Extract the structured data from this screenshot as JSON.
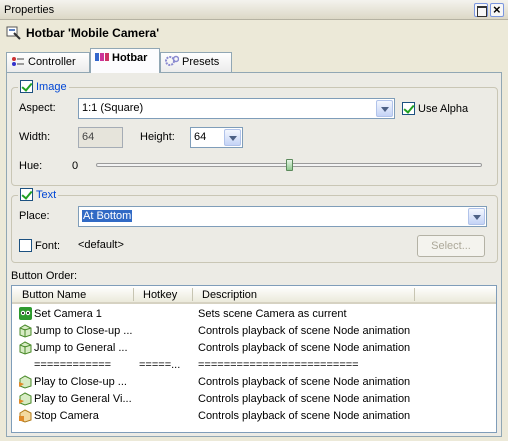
{
  "window": {
    "title": "Properties"
  },
  "header": {
    "title": "Hotbar 'Mobile Camera'"
  },
  "tabs": [
    {
      "label": "Controller",
      "icon": "controller-icon"
    },
    {
      "label": "Hotbar",
      "icon": "hotbar-icon"
    },
    {
      "label": "Presets",
      "icon": "presets-icon"
    }
  ],
  "image_group": {
    "title": "Image",
    "checked": true,
    "aspect_label": "Aspect:",
    "aspect_value": "1:1   (Square)",
    "use_alpha_label": "Use Alpha",
    "use_alpha_checked": true,
    "width_label": "Width:",
    "width_value": "64",
    "height_label": "Height:",
    "height_value": "64",
    "hue_label": "Hue:",
    "hue_value": "0",
    "hue_slider_fraction": 0.5
  },
  "text_group": {
    "title": "Text",
    "checked": true,
    "place_label": "Place:",
    "place_value": "At Bottom",
    "font_label": "Font:",
    "font_checked": false,
    "font_value": "<default>",
    "select_button": "Select..."
  },
  "button_order": {
    "label": "Button Order:",
    "columns": [
      "Button Name",
      "Hotkey",
      "Description"
    ],
    "rows": [
      {
        "name": "Set Camera 1",
        "hotkey": "",
        "description": "Sets scene Camera as current",
        "icon": "camera-icon"
      },
      {
        "name": "Jump to Close-up ...",
        "hotkey": "",
        "description": "Controls playback of scene Node animation",
        "icon": "jump-icon"
      },
      {
        "name": "Jump to General ...",
        "hotkey": "",
        "description": "Controls playback of scene Node animation",
        "icon": "jump-icon"
      },
      {
        "name": "============",
        "hotkey": "=====...",
        "description": "=========================",
        "icon": ""
      },
      {
        "name": "Play to Close-up ...",
        "hotkey": "",
        "description": "Controls playback of scene Node animation",
        "icon": "play-icon"
      },
      {
        "name": "Play to General Vi...",
        "hotkey": "",
        "description": "Controls playback of scene Node animation",
        "icon": "play-icon"
      },
      {
        "name": "Stop Camera",
        "hotkey": "",
        "description": "Controls playback of scene Node animation",
        "icon": "stop-icon"
      }
    ]
  },
  "colors": {
    "group_title": "#0046d5",
    "selection": "#316ac5"
  }
}
